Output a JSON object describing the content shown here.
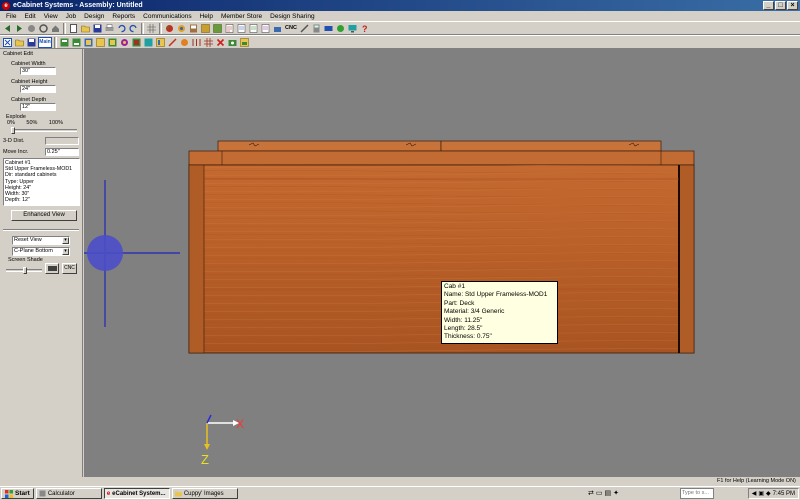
{
  "window": {
    "title": "eCabinet Systems - Assembly: Untitled",
    "icon": "e"
  },
  "menu": [
    "File",
    "Edit",
    "View",
    "Job",
    "Design",
    "Reports",
    "Communications",
    "Help",
    "Member Store",
    "Design Sharing"
  ],
  "toolbar": {
    "cnc_label": "CNC",
    "main_label": "Main"
  },
  "panel": {
    "header": "Cabinet Edit",
    "width_label": "Cabinet Width",
    "width_value": "30\"",
    "height_label": "Cabinet Height",
    "height_value": "24\"",
    "depth_label": "Cabinet Depth",
    "depth_value": "12\"",
    "explode_label": "Explode",
    "explode_ticks": [
      "0%",
      "50%",
      "100%"
    ],
    "dist_label": "3-D Dist.",
    "move_label": "Move Incr.",
    "move_value": "0.25\"",
    "info_lines": [
      "Cabinet #1",
      "Std Upper Frameless-MOD1",
      "Dir: standard cabinets",
      "Type: Upper",
      "Height: 24\"",
      "Width: 30\"",
      "Depth: 12\""
    ],
    "enhanced_button": "Enhanced View",
    "view_select": "Reset View",
    "plane_select": "C-Plane Bottom",
    "shade_label": "Screen Shade",
    "cnc_button": "CNC"
  },
  "tooltip": {
    "lines": [
      "Cab #1",
      "Name: Std Upper Frameless-MOD1",
      "Part: Deck",
      "Material: 3/4 Generic",
      "Width: 11.25\"",
      "Length: 28.5\"",
      "Thickness: 0.75\""
    ]
  },
  "axes": {
    "x": "X",
    "z": "Z"
  },
  "status": {
    "help": "F1 for Help (Learning Mode ON)"
  },
  "taskbar": {
    "start": "Start",
    "tasks": [
      "Calculator",
      "eCabinet System...",
      "Cuppy' Images"
    ],
    "search_placeholder": "Type to s...",
    "clock": "7:45 PM"
  },
  "colors": {
    "viewport_bg": "#808080",
    "wood": "#b8602a",
    "gizmo": "#2e33b0",
    "title_blue": "#0a246a"
  }
}
